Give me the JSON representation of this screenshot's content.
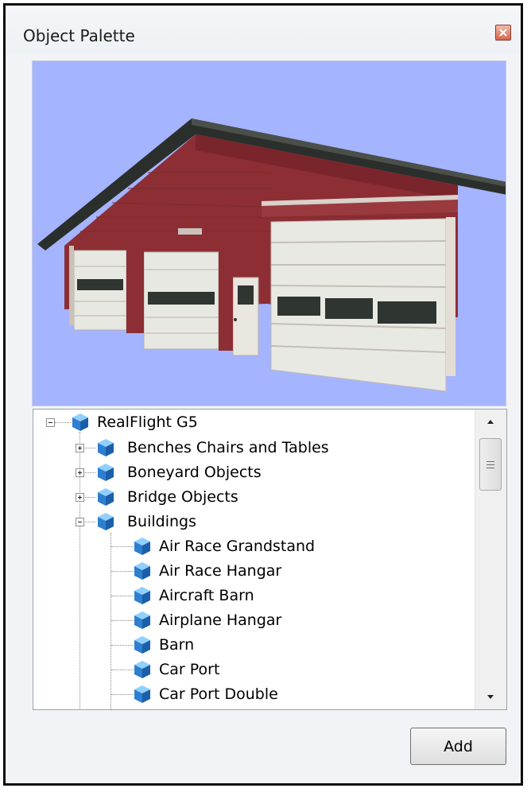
{
  "window": {
    "title": "Object Palette"
  },
  "tree": {
    "root": {
      "label": "RealFlight G5",
      "expanded": true
    },
    "categories": [
      {
        "label": "Benches Chairs and Tables",
        "expanded": false
      },
      {
        "label": "Boneyard Objects",
        "expanded": false
      },
      {
        "label": "Bridge Objects",
        "expanded": false
      },
      {
        "label": "Buildings",
        "expanded": true
      }
    ],
    "buildings": [
      "Air Race Grandstand",
      "Air Race Hangar",
      "Aircraft Barn",
      "Airplane Hangar",
      "Barn",
      "Car Port",
      "Car Port Double"
    ]
  },
  "buttons": {
    "add": "Add"
  },
  "colors": {
    "preview_background": "#a5b4ff",
    "barn_red": "#8d2e34",
    "tree_icon": "#3a8fd8"
  }
}
